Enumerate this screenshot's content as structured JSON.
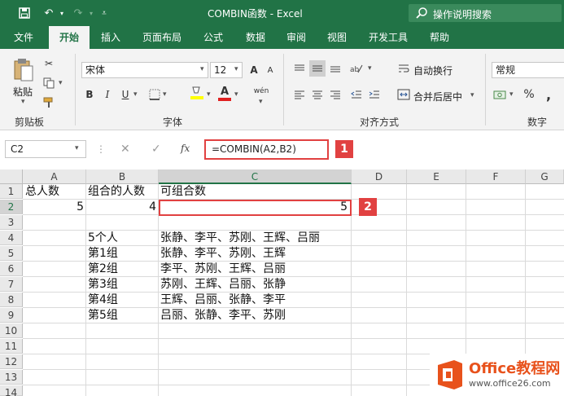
{
  "titlebar": {
    "title": "COMBIN函数  -  Excel",
    "tell_me": "操作说明搜索"
  },
  "menu_tabs": [
    "文件",
    "开始",
    "插入",
    "页面布局",
    "公式",
    "数据",
    "审阅",
    "视图",
    "开发工具",
    "帮助"
  ],
  "ribbon": {
    "clipboard": {
      "paste_label": "粘贴",
      "group_label": "剪贴板"
    },
    "font": {
      "font_name": "宋体",
      "font_size": "12",
      "group_label": "字体",
      "bold": "B",
      "italic": "I",
      "underline": "U",
      "font_color_letter": "A",
      "grow_letter": "A",
      "phonetic": "wén"
    },
    "alignment": {
      "wrap_label": "自动换行",
      "merge_label": "合并后居中",
      "group_label": "对齐方式"
    },
    "number": {
      "format": "常规",
      "group_label": "数字",
      "percent": "%",
      "comma": ","
    }
  },
  "formula_bar": {
    "name_box": "C2",
    "cancel": "✕",
    "enter": "✓",
    "fx": "fx",
    "formula": "=COMBIN(A2,B2)"
  },
  "callouts": [
    "1",
    "2"
  ],
  "columns": [
    "A",
    "B",
    "C",
    "D",
    "E",
    "F",
    "G"
  ],
  "rows": [
    "1",
    "2",
    "3",
    "4",
    "5",
    "6",
    "7",
    "8",
    "9",
    "10",
    "11",
    "12",
    "13",
    "14"
  ],
  "cells": {
    "A1": "总人数",
    "B1": "组合的人数",
    "C1": "可组合数",
    "A2": "5",
    "B2": "4",
    "C2": "5",
    "B4": "5个人",
    "C4": "张静、李平、苏刚、王辉、吕丽",
    "B5": "第1组",
    "C5": "张静、李平、苏刚、王辉",
    "B6": "第2组",
    "C6": "李平、苏刚、王辉、吕丽",
    "B7": "第3组",
    "C7": "苏刚、王辉、吕丽、张静",
    "B8": "第4组",
    "C8": "王辉、吕丽、张静、李平",
    "B9": "第5组",
    "C9": "吕丽、张静、李平、苏刚"
  },
  "logo": {
    "name": "Office教程网",
    "url": "www.office26.com"
  }
}
